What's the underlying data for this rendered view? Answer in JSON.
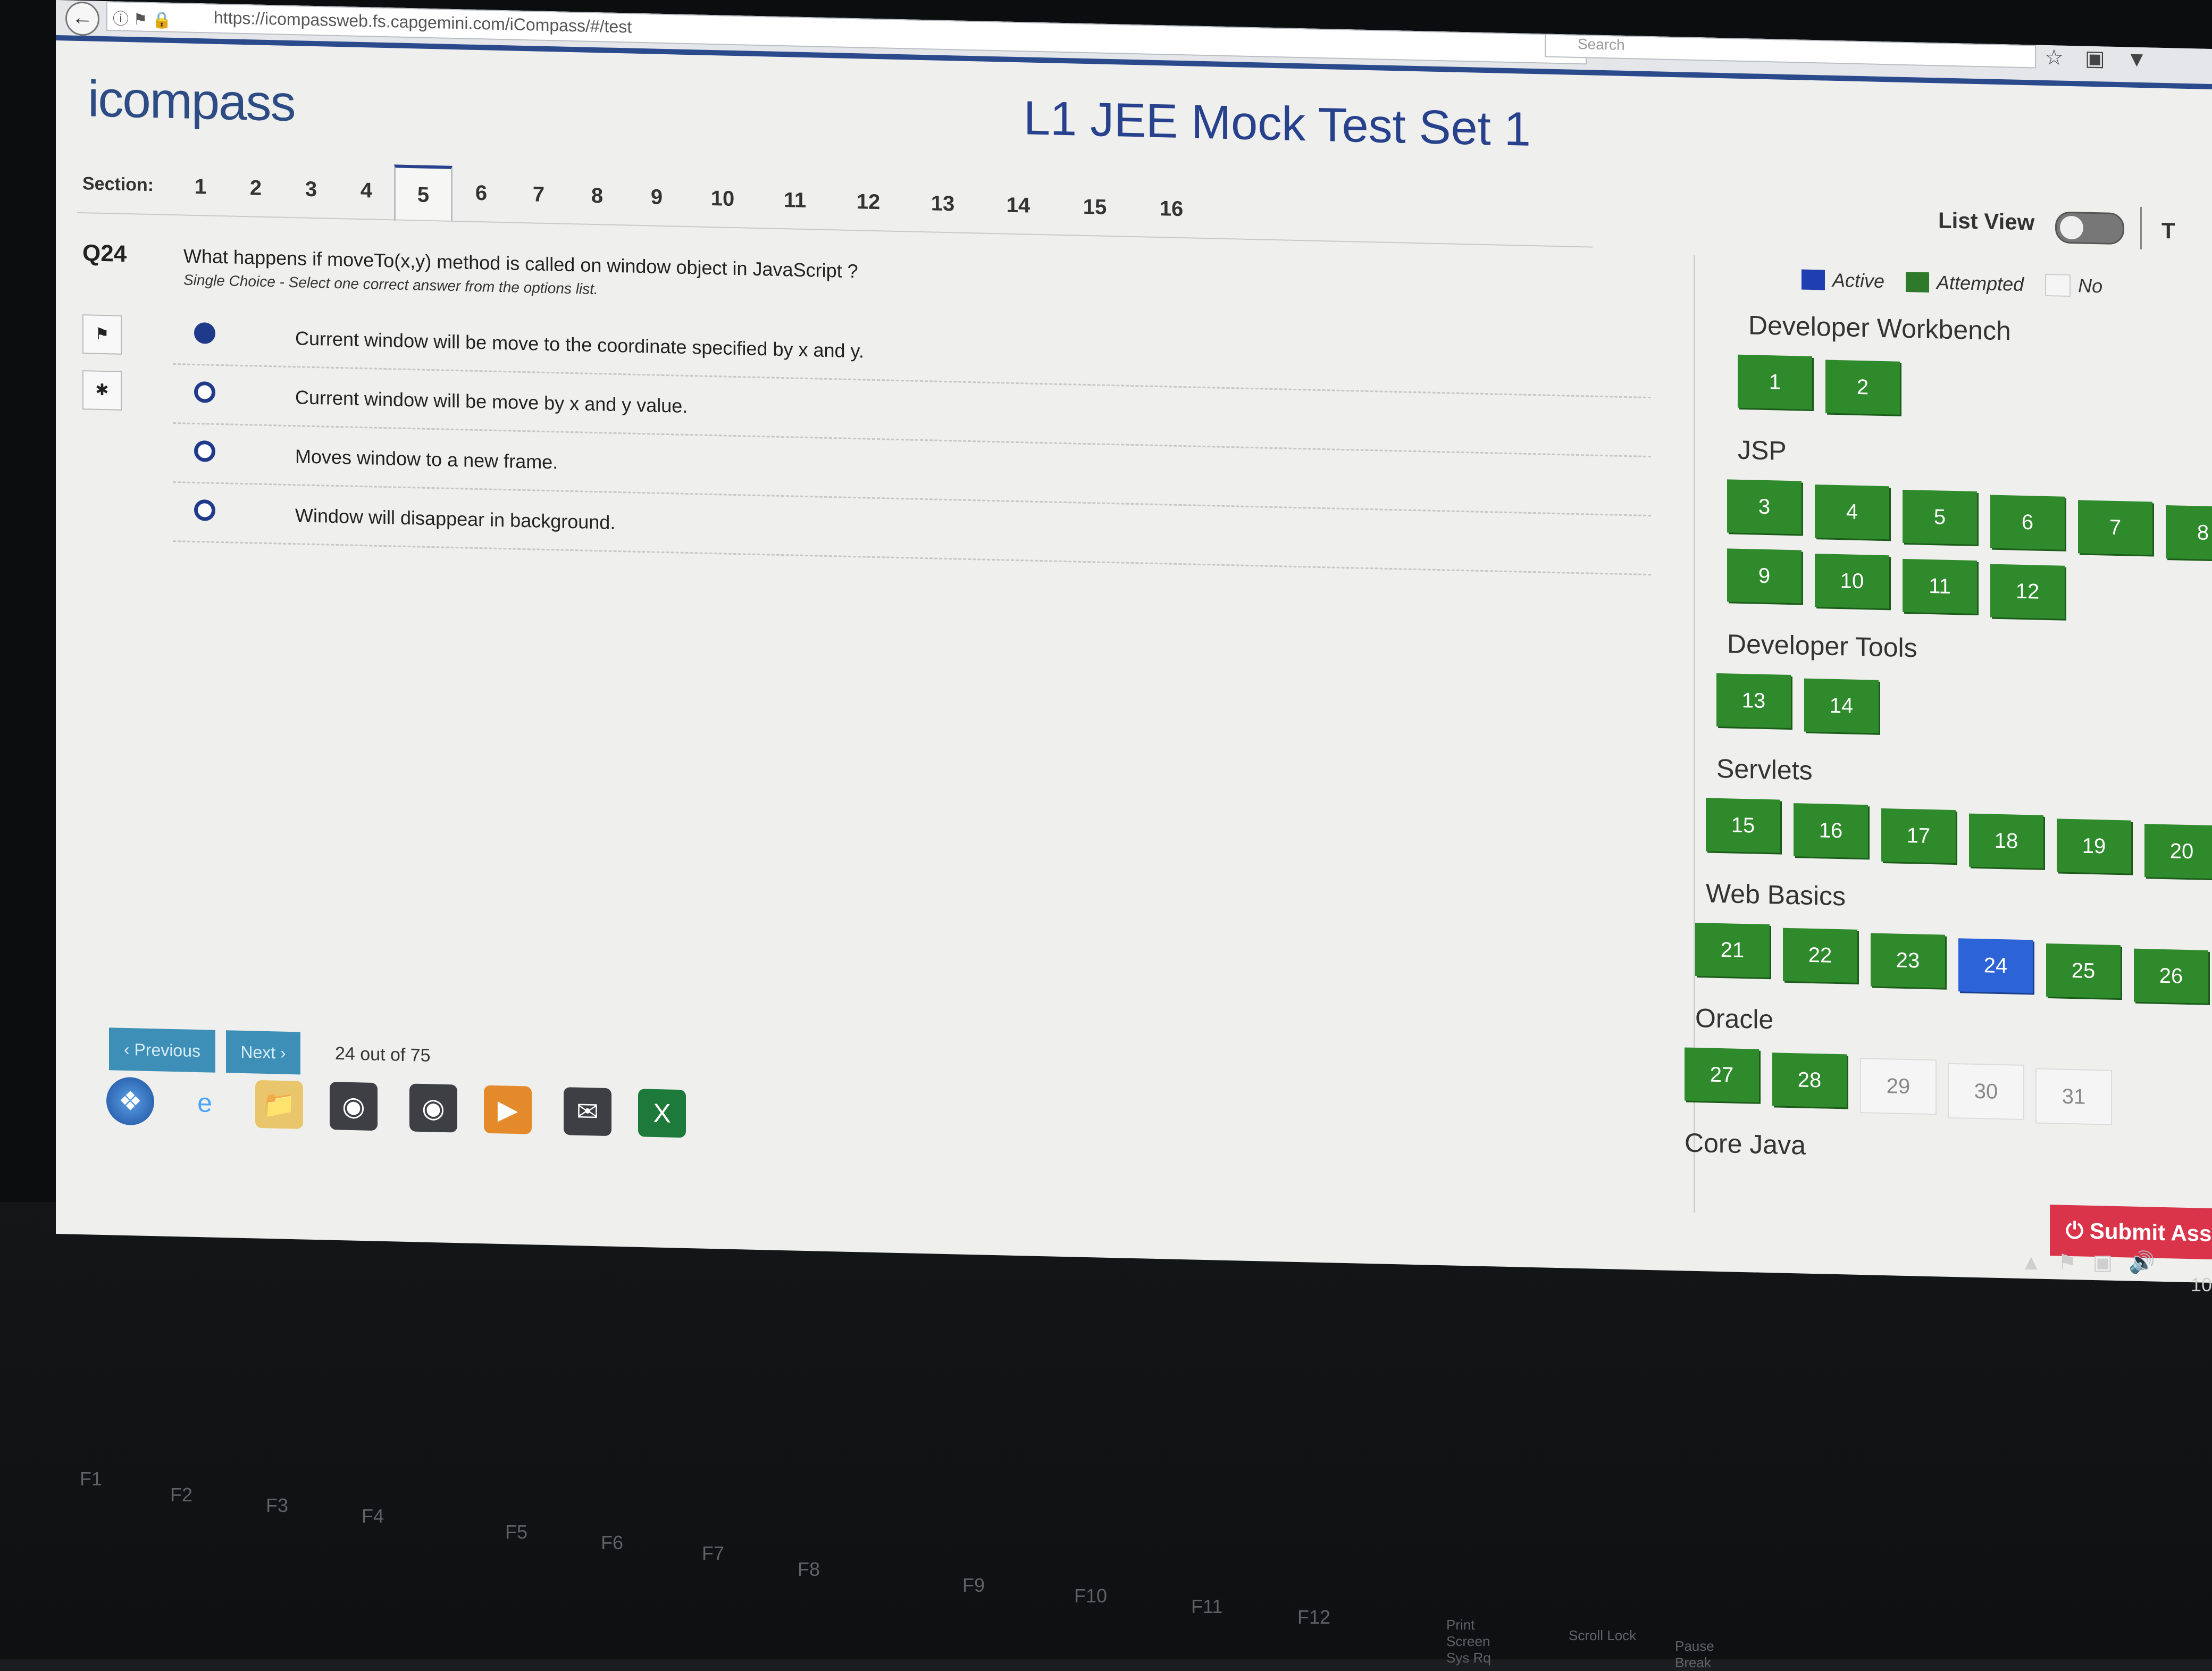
{
  "browser": {
    "url": "https://icompassweb.fs.capgemini.com/iCompass/#/test",
    "search_placeholder": "Search"
  },
  "header": {
    "logo": "icompass",
    "title": "L1 JEE Mock Test Set 1",
    "section_label": "Section:",
    "sections": [
      "1",
      "2",
      "3",
      "4",
      "5",
      "6",
      "7",
      "8",
      "9",
      "10",
      "11",
      "12",
      "13",
      "14",
      "15",
      "16"
    ],
    "active_section": "5",
    "list_view_label": "List View",
    "cut_label": "T"
  },
  "question": {
    "number": "Q24",
    "text": "What happens if moveTo(x,y) method is called on window object in JavaScript ?",
    "subtext": "Single Choice - Select one correct answer from the options list.",
    "options": [
      {
        "text": "Current window will be move to the coordinate specified by x and y.",
        "selected": true
      },
      {
        "text": "Current window will be move by x and y value.",
        "selected": false
      },
      {
        "text": "Moves window to a new frame.",
        "selected": false
      },
      {
        "text": "Window will disappear in background.",
        "selected": false
      }
    ]
  },
  "nav": {
    "previous": "‹ Previous",
    "next": "Next ›",
    "progress": "24 out of 75"
  },
  "legend": {
    "active": "Active",
    "attempted": "Attempted",
    "not_attempted": "No",
    "colors": {
      "active": "#2c63d6",
      "attempted": "#2f8a2c",
      "not_attempted": "#f5f5f5"
    }
  },
  "groups": [
    {
      "title": "Developer Workbench",
      "items": [
        {
          "n": "1",
          "s": "attempted"
        },
        {
          "n": "2",
          "s": "attempted"
        }
      ]
    },
    {
      "title": "JSP",
      "items": [
        {
          "n": "3",
          "s": "attempted"
        },
        {
          "n": "4",
          "s": "attempted"
        },
        {
          "n": "5",
          "s": "attempted"
        },
        {
          "n": "6",
          "s": "attempted"
        },
        {
          "n": "7",
          "s": "attempted"
        },
        {
          "n": "8",
          "s": "attempted"
        },
        {
          "n": "9",
          "s": "attempted"
        },
        {
          "n": "10",
          "s": "attempted"
        },
        {
          "n": "11",
          "s": "attempted"
        },
        {
          "n": "12",
          "s": "attempted"
        }
      ]
    },
    {
      "title": "Developer Tools",
      "items": [
        {
          "n": "13",
          "s": "attempted"
        },
        {
          "n": "14",
          "s": "attempted"
        }
      ]
    },
    {
      "title": "Servlets",
      "items": [
        {
          "n": "15",
          "s": "attempted"
        },
        {
          "n": "16",
          "s": "attempted"
        },
        {
          "n": "17",
          "s": "attempted"
        },
        {
          "n": "18",
          "s": "attempted"
        },
        {
          "n": "19",
          "s": "attempted"
        },
        {
          "n": "20",
          "s": "attempted"
        }
      ]
    },
    {
      "title": "Web Basics",
      "items": [
        {
          "n": "21",
          "s": "attempted"
        },
        {
          "n": "22",
          "s": "attempted"
        },
        {
          "n": "23",
          "s": "attempted"
        },
        {
          "n": "24",
          "s": "active"
        },
        {
          "n": "25",
          "s": "attempted"
        },
        {
          "n": "26",
          "s": "attempted"
        }
      ]
    },
    {
      "title": "Oracle",
      "items": [
        {
          "n": "27",
          "s": "attempted"
        },
        {
          "n": "28",
          "s": "attempted"
        },
        {
          "n": "29",
          "s": "unattempted"
        },
        {
          "n": "30",
          "s": "unattempted"
        },
        {
          "n": "31",
          "s": "unattempted"
        }
      ]
    },
    {
      "title": "Core Java",
      "items": []
    }
  ],
  "submit_label": "⏻ Submit Asse",
  "tray": {
    "time": "10"
  },
  "taskbar_icons": [
    "start-orb-icon",
    "internet-explorer-icon",
    "file-explorer-icon",
    "chrome-icon",
    "firefox-icon",
    "media-player-icon",
    "outlook-icon",
    "excel-icon"
  ],
  "keyboard_labels": [
    "F1",
    "F2",
    "F3",
    "F4",
    "F5",
    "F6",
    "F7",
    "F8",
    "F9",
    "F10",
    "F11",
    "F12",
    "Print Screen Sys Rq",
    "Scroll Lock",
    "Pause Break"
  ]
}
